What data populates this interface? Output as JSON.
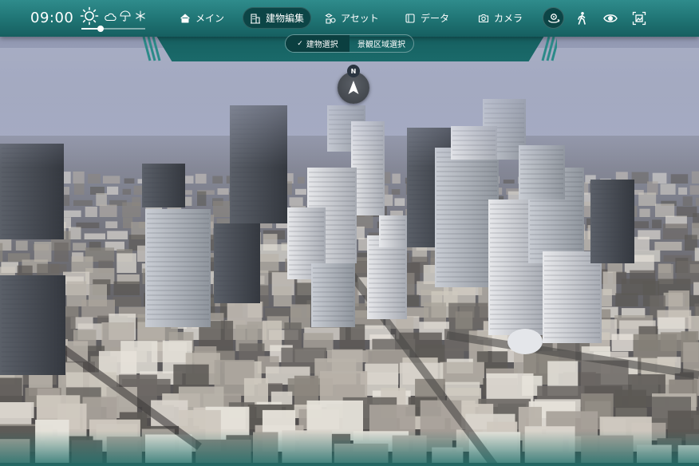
{
  "clock": {
    "time": "09:00"
  },
  "weather": {
    "icons": [
      "sun-icon",
      "cloud-icon",
      "umbrella-icon",
      "snowflake-icon"
    ],
    "selected": "sun-icon",
    "time_of_day_position": 0.3
  },
  "nav": {
    "items": [
      {
        "id": "main",
        "label": "メイン",
        "icon": "home-icon",
        "active": false
      },
      {
        "id": "building-edit",
        "label": "建物編集",
        "icon": "building-icon",
        "active": true
      },
      {
        "id": "asset",
        "label": "アセット",
        "icon": "asset-icon",
        "active": false
      },
      {
        "id": "data",
        "label": "データ",
        "icon": "data-icon",
        "active": false
      },
      {
        "id": "camera",
        "label": "カメラ",
        "icon": "camera-icon",
        "active": false
      }
    ]
  },
  "tools": [
    {
      "id": "view-rotate",
      "icon": "rotate-view-icon",
      "active": true
    },
    {
      "id": "walk",
      "icon": "walk-icon",
      "active": false
    },
    {
      "id": "eye",
      "icon": "eye-icon",
      "active": false
    },
    {
      "id": "select-region",
      "icon": "select-region-icon",
      "active": false
    }
  ],
  "subtabs": {
    "items": [
      {
        "label": "建物選択",
        "active": true
      },
      {
        "label": "景観区域選択",
        "active": false
      }
    ],
    "check": "✓"
  },
  "compass": {
    "north_label": "N"
  },
  "colors": {
    "bar": "#1f7373",
    "bar_light": "#2f8c8c",
    "active_pill": "#0c4546",
    "text": "#ffffff",
    "sky": "#a7adc4"
  }
}
